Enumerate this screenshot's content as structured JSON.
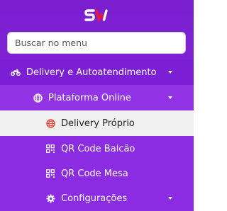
{
  "brand": {
    "logo_text": "SW",
    "accent": "#e8173a"
  },
  "search": {
    "placeholder": "Buscar no menu"
  },
  "menu": {
    "delivery": {
      "label": "Delivery e Autoatendimento",
      "icon": "motorcycle-icon"
    },
    "plataforma": {
      "label": "Plataforma Online",
      "icon": "globe-icon"
    },
    "items": [
      {
        "label": "Delivery Próprio",
        "icon": "globe-icon",
        "active": true
      },
      {
        "label": "QR Code Balcão",
        "icon": "qrcode-icon"
      },
      {
        "label": "QR Code Mesa",
        "icon": "qrcode-icon"
      }
    ],
    "configuracoes": {
      "label": "Configurações",
      "icon": "gear-icon"
    }
  },
  "colors": {
    "sidebar": "#7a1fd0",
    "active_bg": "#f0f0f0"
  }
}
